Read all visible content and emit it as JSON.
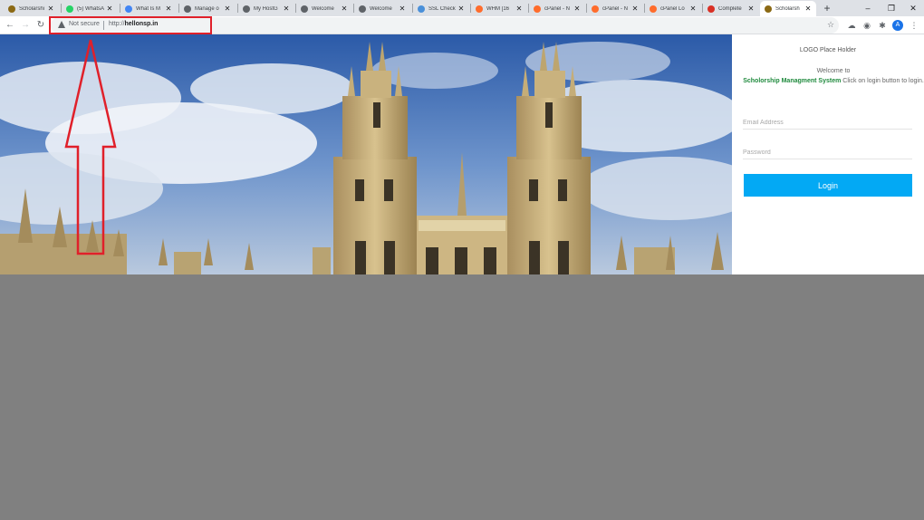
{
  "browser": {
    "tabs": [
      {
        "label": "Scholarshi",
        "color": "#8b6914"
      },
      {
        "label": "(5) WhatsA",
        "color": "#25d366"
      },
      {
        "label": "What Is M",
        "color": "#4285f4"
      },
      {
        "label": "Manage o",
        "color": "#5f6368"
      },
      {
        "label": "My HostG",
        "color": "#5f6368"
      },
      {
        "label": "Welcome",
        "color": "#5f6368"
      },
      {
        "label": "Welcome",
        "color": "#5f6368"
      },
      {
        "label": "SSL Check",
        "color": "#4a90d9"
      },
      {
        "label": "WHM [16",
        "color": "#ff6c2c"
      },
      {
        "label": "cPanel - N",
        "color": "#ff6c2c"
      },
      {
        "label": "cPanel - N",
        "color": "#ff6c2c"
      },
      {
        "label": "cPanel Lo",
        "color": "#ff6c2c"
      },
      {
        "label": "Complete",
        "color": "#d93025"
      },
      {
        "label": "Scholarsh",
        "color": "#8b6914"
      }
    ],
    "new_tab": "+",
    "address": {
      "security_label": "Not secure",
      "url_prefix": "http://",
      "url_host": "hellonsp.in"
    },
    "avatar_letter": "A"
  },
  "login_panel": {
    "logo_placeholder": "LOGO Place Holder",
    "welcome_prefix": "Welcome to",
    "app_name": "Scholorship Managment System",
    "welcome_suffix": "Click on login button to login.",
    "email_placeholder": "Email Address",
    "password_placeholder": "Password",
    "login_label": "Login"
  },
  "colors": {
    "annotation_red": "#e0202a",
    "login_button": "#03a9f4",
    "brand_green": "#1f8a3d",
    "backdrop": "#808080"
  }
}
